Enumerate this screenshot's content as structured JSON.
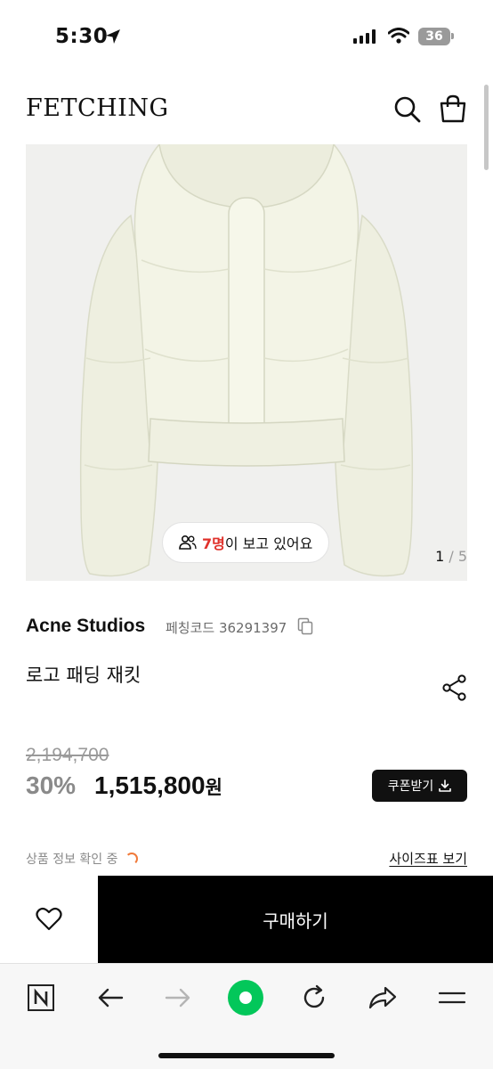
{
  "status_bar": {
    "time": "5:30",
    "battery": "36",
    "icons": [
      "location-arrow-icon",
      "signal-icon",
      "wifi-icon",
      "battery-icon"
    ]
  },
  "header": {
    "brand": "FETCHING",
    "icons": [
      "search-icon",
      "shopping-bag-icon"
    ]
  },
  "gallery": {
    "viewer_count": "7명",
    "viewer_text": "이 보고 있어요",
    "current_image": "1",
    "total_images": "/ 5"
  },
  "product": {
    "brand": "Acne Studios",
    "code_label": "페칭코드 36291397",
    "name": "로고 패딩 재킷",
    "original_price": "2,194,700",
    "discount_rate": "30%",
    "sale_price": "1,515,800",
    "currency": "원",
    "coupon_label": "쿠폰받기",
    "info_status": "상품 정보 확인 중",
    "size_chart": "사이즈표 보기"
  },
  "purchase_bar": {
    "buy_label": "구매하기"
  },
  "colors": {
    "accent_red": "#e0312b",
    "spinner_orange": "#f07a3a",
    "naver_green": "#03c75a",
    "buy_black": "#000000"
  }
}
